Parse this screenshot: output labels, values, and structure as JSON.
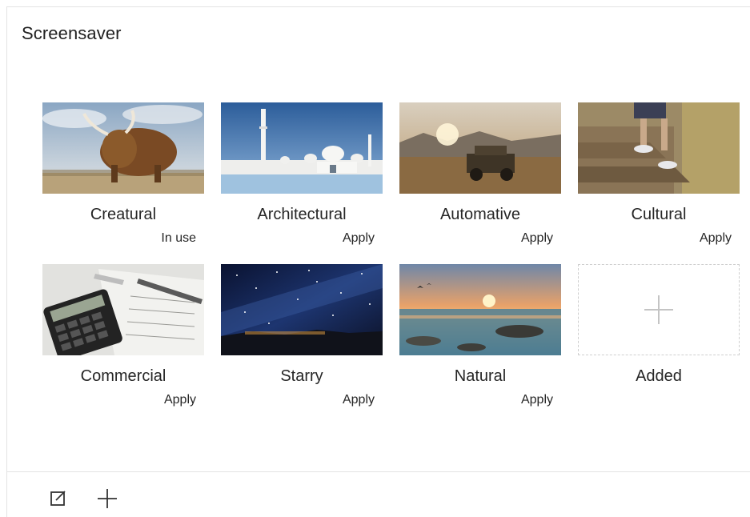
{
  "header": {
    "title": "Screensaver"
  },
  "screensavers": [
    {
      "label": "Creatural",
      "status": "In use"
    },
    {
      "label": "Architectural",
      "status": "Apply"
    },
    {
      "label": "Automative",
      "status": "Apply"
    },
    {
      "label": "Cultural",
      "status": "Apply"
    },
    {
      "label": "Commercial",
      "status": "Apply"
    },
    {
      "label": "Starry",
      "status": "Apply"
    },
    {
      "label": "Natural",
      "status": "Apply"
    }
  ],
  "add_tile": {
    "label": "Added",
    "icon": "plus-icon"
  },
  "toolbar": {
    "edit_icon": "edit-icon",
    "add_icon": "plus-icon"
  },
  "colors": {
    "border": "#e3e3e3",
    "dashed": "#cfcfcf",
    "text": "#212121"
  }
}
